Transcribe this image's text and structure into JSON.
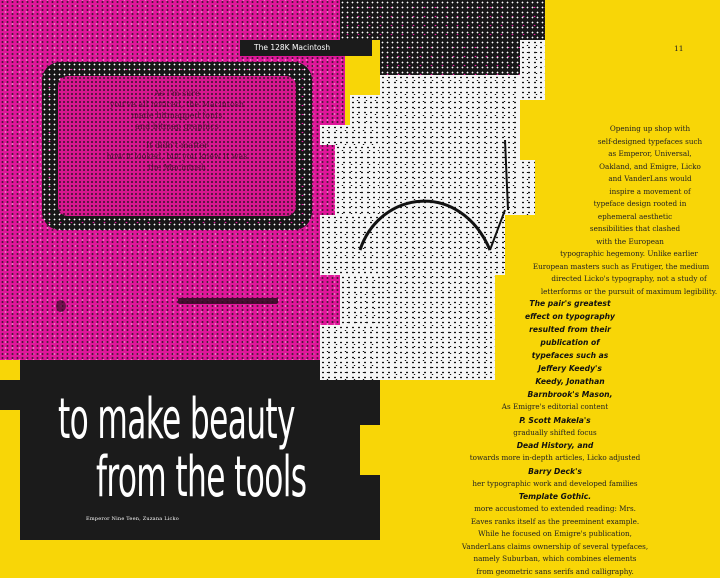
{
  "header": {
    "section_label": "The 128K Macintosh",
    "page_number": "11"
  },
  "headline": {
    "line1": "to make beauty",
    "line2": "from the tools"
  },
  "caption_credit": "Emperor Nine Teen, Zuzana Licko",
  "body_top": [
    "Opening up shop with",
    "self-designed typefaces such",
    "as Emperor, Universal,",
    "Oakland, and Emigre, Licko",
    "and VanderLans would",
    "inspire a movement of",
    "typeface design rooted in",
    "ephemeral aesthetic",
    "sensibilities that clashed",
    "with the European",
    "typographic hegemony. Unlike earlier",
    "European masters such as Frutiger, the medium",
    "directed Licko's typography, not a study of",
    "letterforms or the pursuit of maximum legibility."
  ],
  "pull_quote": [
    "The pair's greatest",
    "effect on typography",
    "resulted from their",
    "publication of",
    "typefaces such as",
    "Jeffery Keedy's",
    "Keedy, Jonathan",
    "Barnbrook's Mason,"
  ],
  "interleaved": [
    {
      "text": "As Emigre's editorial content",
      "style": "body"
    },
    {
      "text": "P. Scott Makela's",
      "style": "quote"
    },
    {
      "text": "gradually shifted focus",
      "style": "body"
    },
    {
      "text": "Dead History, and",
      "style": "quote"
    },
    {
      "text": "towards more in-depth articles, Licko adjusted",
      "style": "body"
    },
    {
      "text": "Barry Deck's",
      "style": "quote"
    },
    {
      "text": "her typographic work and developed families",
      "style": "body"
    },
    {
      "text": "Template Gothic.",
      "style": "quote"
    },
    {
      "text": "more accustomed to extended reading: Mrs.",
      "style": "body"
    },
    {
      "text": "Eaves ranks itself as the preeminent example.",
      "style": "body"
    },
    {
      "text": "While he focused on Emigre's publication,",
      "style": "body"
    },
    {
      "text": "VanderLans claims ownership of several typefaces,",
      "style": "body"
    },
    {
      "text": "namely Suburban, which combines elements",
      "style": "body"
    },
    {
      "text": "from geometric sans serifs and calligraphy.",
      "style": "body"
    }
  ],
  "screen_text": [
    "As I'm sure",
    "you've all noticed, the Macintosh",
    "made bitmapped fonts",
    "and bitmap graphics",
    "It didn't matter",
    "how it looked, but you knew it was",
    "the Macintosh"
  ],
  "colors": {
    "yellow": "#f8d607",
    "magenta": "#e0169a",
    "black": "#1b1b1b",
    "white": "#f6f6f6"
  }
}
